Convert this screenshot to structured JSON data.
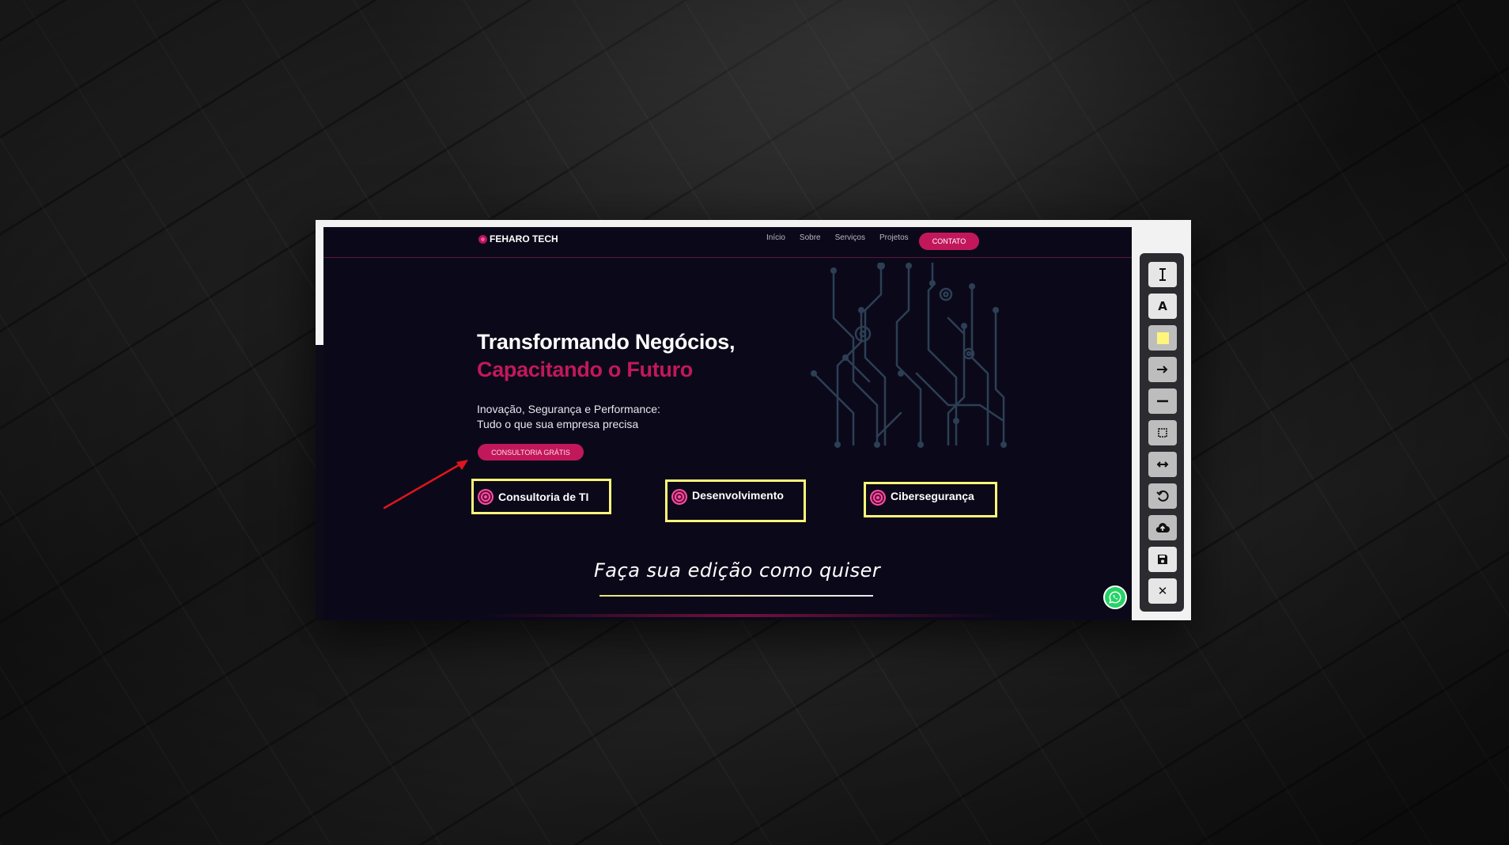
{
  "site": {
    "brand": "FEHARO TECH",
    "nav": [
      "Início",
      "Sobre",
      "Serviços",
      "Projetos"
    ],
    "nav_cta": "CONTATO",
    "hero_title_line1": "Transformando Negócios,",
    "hero_title_line2": "Capacitando o Futuro",
    "hero_subtitle_line1": "Inovação, Segurança e Performance:",
    "hero_subtitle_line2": "Tudo o que sua empresa precisa",
    "hero_button": "CONSULTORIA GRÁTIS",
    "services": [
      "Consultoria de TI",
      "Desenvolvimento",
      "Cibersegurança"
    ]
  },
  "annotation": {
    "edit_text": "Faça sua edição como quiser"
  },
  "toolbar": {
    "tools": [
      {
        "icon": "text-cursor-icon",
        "glyph": "I"
      },
      {
        "icon": "text-icon",
        "glyph": "A"
      },
      {
        "icon": "highlight-color-icon"
      },
      {
        "icon": "arrow-icon"
      },
      {
        "icon": "line-icon"
      },
      {
        "icon": "rectangle-icon"
      },
      {
        "icon": "double-arrow-icon"
      },
      {
        "icon": "undo-icon"
      },
      {
        "icon": "upload-cloud-icon"
      },
      {
        "icon": "save-icon"
      },
      {
        "icon": "close-icon",
        "glyph": "✕"
      }
    ]
  },
  "colors": {
    "accent": "#c2185b",
    "highlight": "#fff57a",
    "site_bg": "#0b0919",
    "annotation_arrow": "#e0151c",
    "whatsapp": "#25d366"
  }
}
